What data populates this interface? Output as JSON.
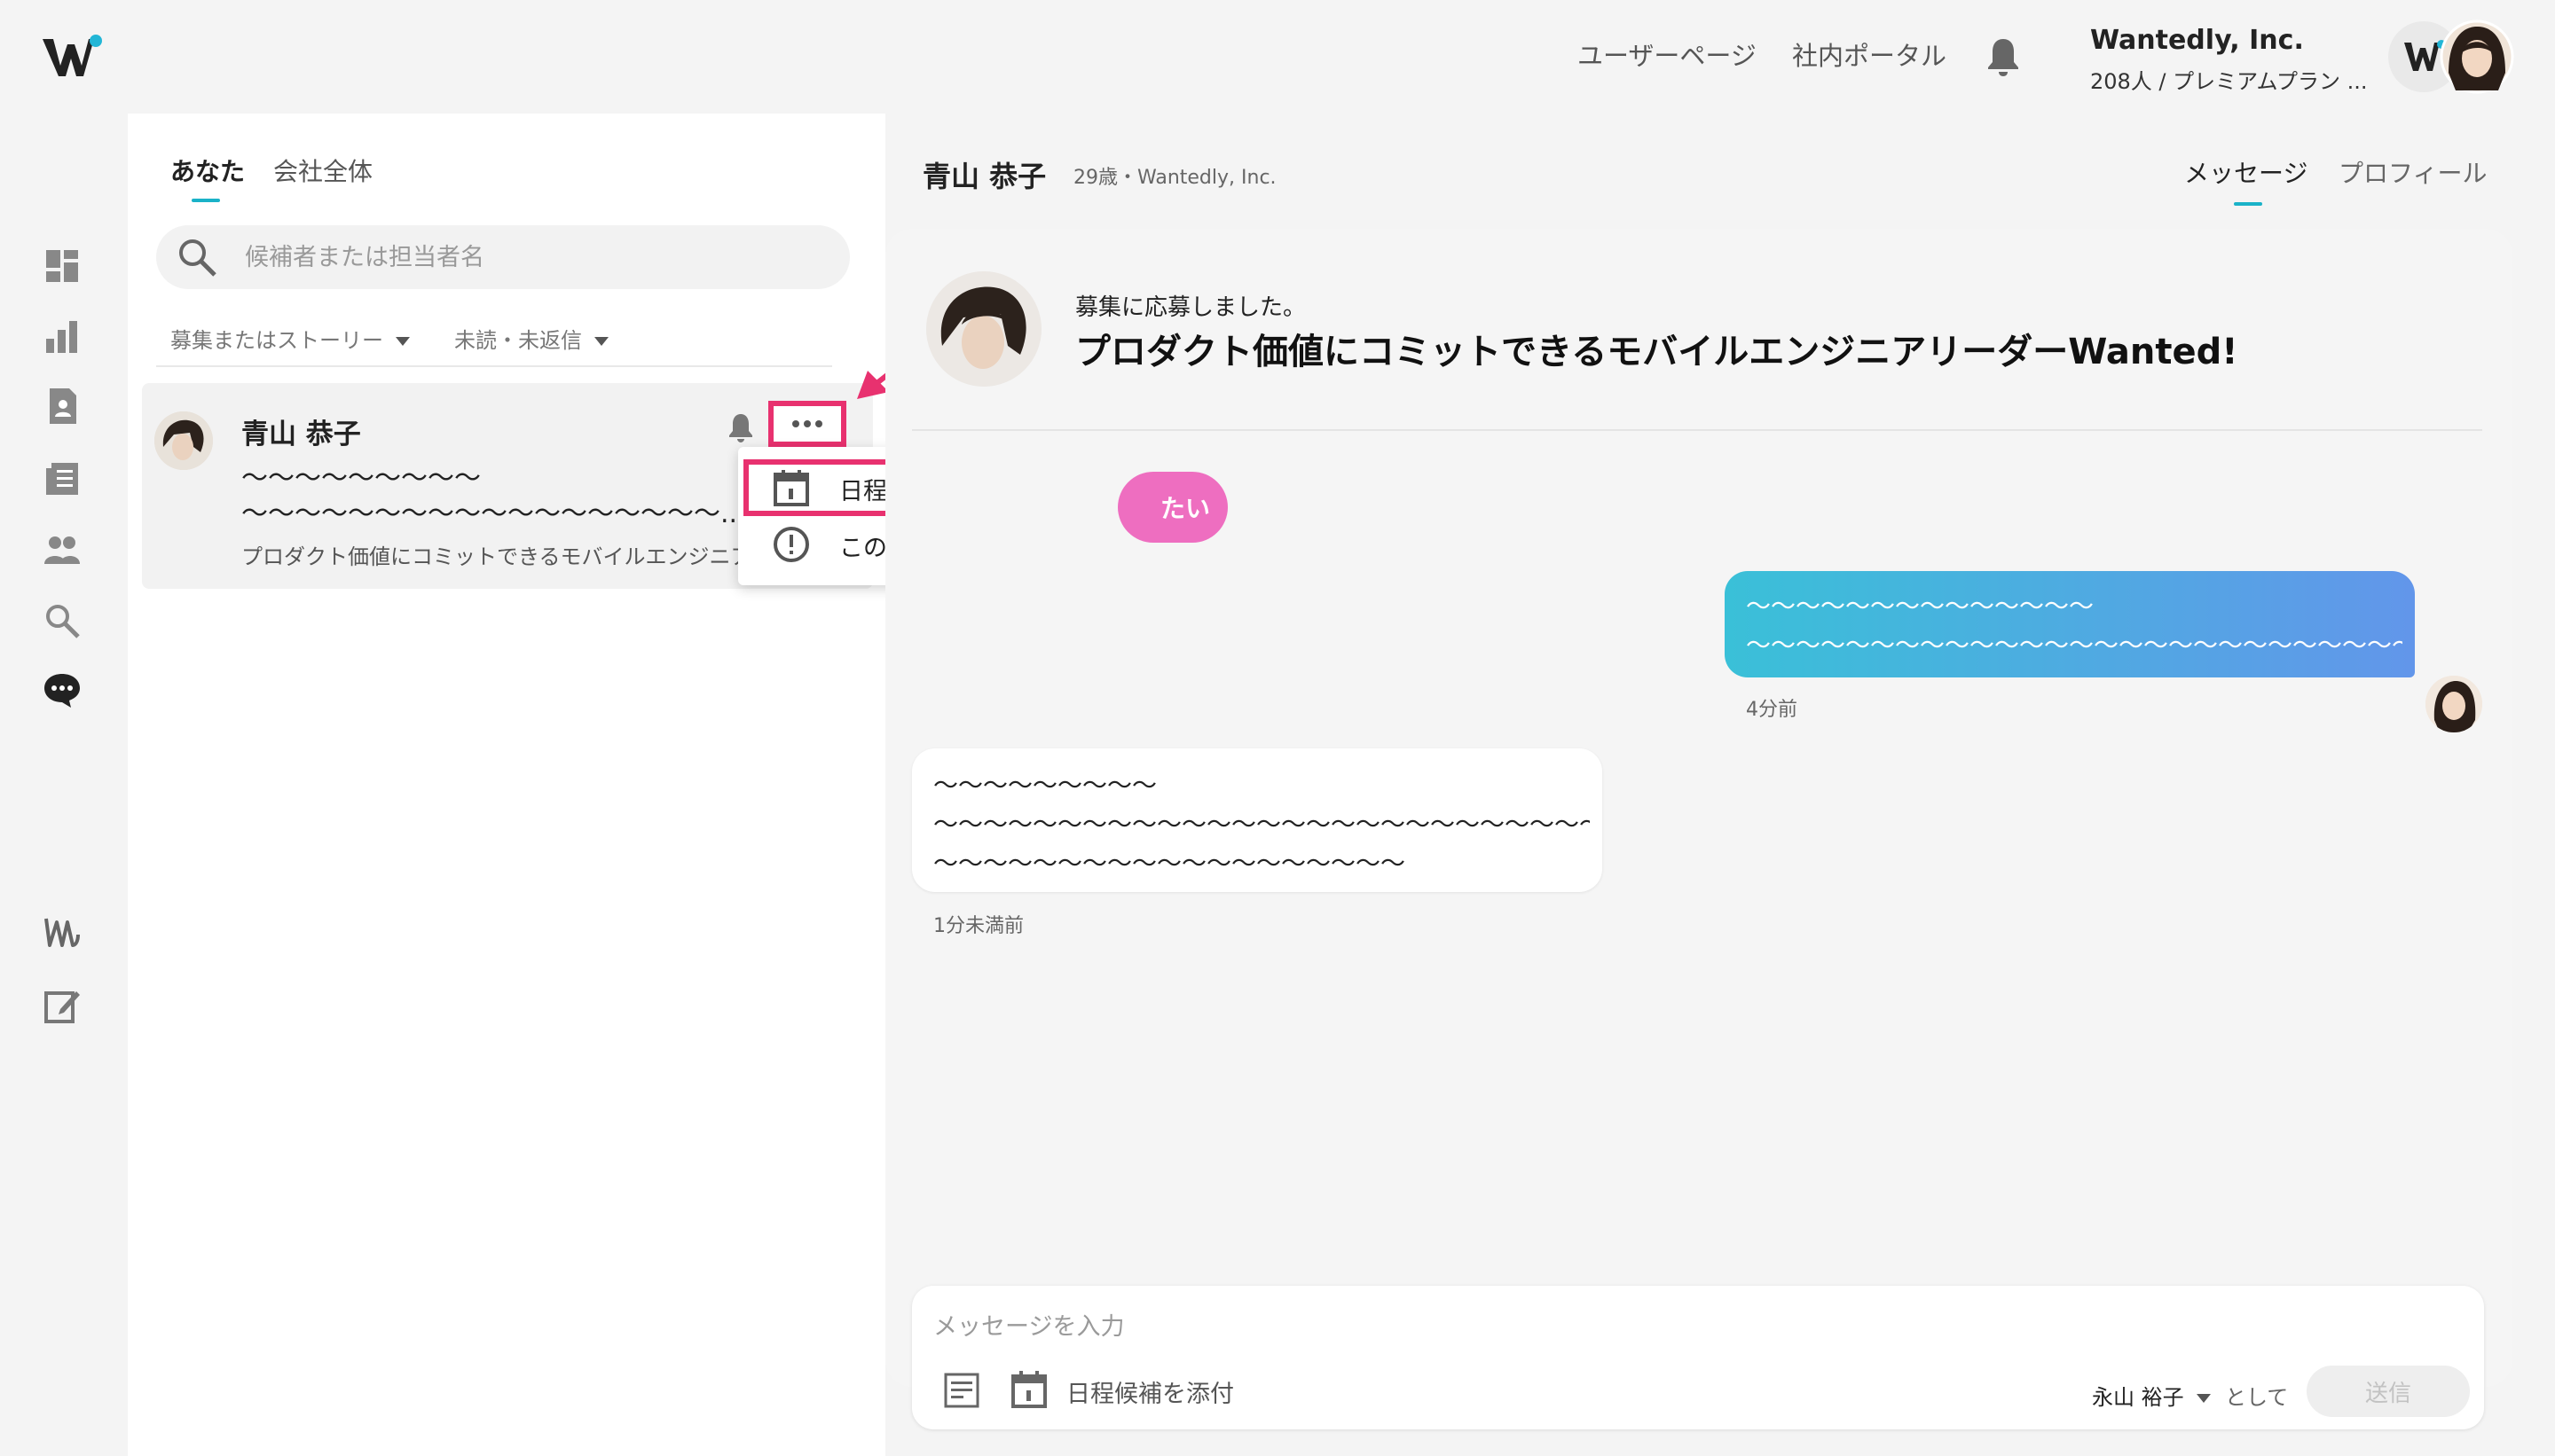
{
  "header": {
    "nav_links": [
      "ユーザーページ",
      "社内ポータル"
    ],
    "company_name": "Wantedly, Inc.",
    "company_sub": "208人 / プレミアムプラン ..."
  },
  "left": {
    "tabs": [
      "あなた",
      "会社全体"
    ],
    "active_tab": "あなた",
    "search_placeholder": "候補者または担当者名",
    "filters": [
      "募集またはストーリー",
      "未読・未返信"
    ],
    "conversation": {
      "name": "青山 恭子",
      "line1": "〜〜〜〜〜〜〜〜〜",
      "line2": "〜〜〜〜〜〜〜〜〜〜〜〜〜〜〜〜〜〜...",
      "job": "プロダクト価値にコミットできるモバイルエンジニア"
    },
    "menu_items": [
      {
        "label": "日程のリマインド",
        "icon": "calendar-icon"
      },
      {
        "label": "このユーザーを報告",
        "icon": "alert-circle-icon"
      }
    ]
  },
  "right": {
    "name": "青山 恭子",
    "meta": "29歳・Wantedly, Inc.",
    "tabs": [
      "メッセージ",
      "プロフィール"
    ],
    "active_tab": "メッセージ",
    "applied_label": "募集に応募しました。",
    "job_title": "プロダクト価値にコミットできるモバイルエンジニアリーダーWanted!",
    "pill_text": "たい",
    "outgoing": {
      "lines": [
        "〜〜〜〜〜〜〜〜〜〜〜〜〜〜",
        "〜〜〜〜〜〜〜〜〜〜〜〜〜〜〜〜〜〜〜〜〜〜〜〜〜〜〜"
      ],
      "time": "4分前"
    },
    "incoming": {
      "lines": [
        "〜〜〜〜〜〜〜〜〜",
        "〜〜〜〜〜〜〜〜〜〜〜〜〜〜〜〜〜〜〜〜〜〜〜〜〜〜〜",
        "〜〜〜〜〜〜〜〜〜〜〜〜〜〜〜〜〜〜〜"
      ],
      "time": "1分未満前"
    }
  },
  "compose": {
    "placeholder": "メッセージを入力",
    "attach_label": "日程候補を添付",
    "sender": "永山 裕子",
    "as_label": "として",
    "send_label": "送信"
  },
  "colors": {
    "accent": "#1ab2c8",
    "highlight": "#e8316f",
    "pill": "#ee6ec0",
    "bubble_start": "#3ac0d8",
    "bubble_end": "#6296ea"
  }
}
